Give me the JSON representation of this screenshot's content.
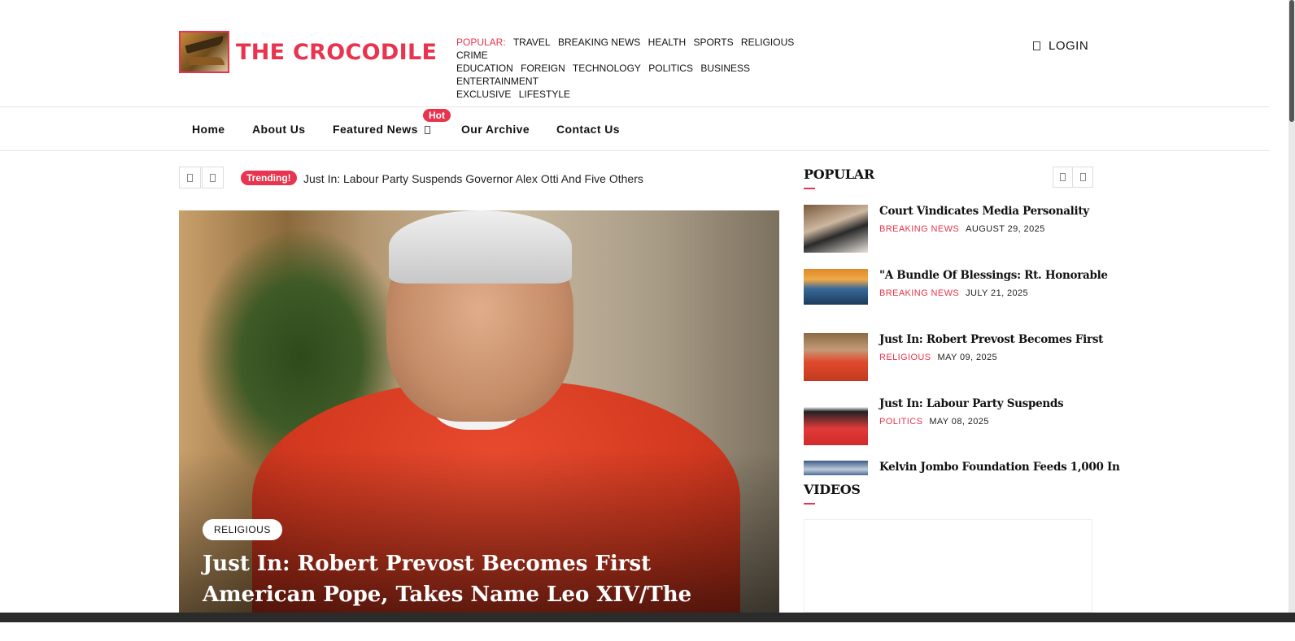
{
  "header": {
    "logo_text": "THE CROCODILE",
    "popular_label": "POPULAR:",
    "popular_links": [
      "TRAVEL",
      "BREAKING NEWS",
      "HEALTH",
      "SPORTS",
      "RELIGIOUS",
      "CRIME",
      "EDUCATION",
      "FOREIGN",
      "TECHNOLOGY",
      "POLITICS",
      "BUSINESS",
      "ENTERTAINMENT",
      "EXCLUSIVE",
      "LIFESTYLE"
    ],
    "login_label": "LOGIN"
  },
  "nav": {
    "items": [
      "Home",
      "About Us",
      "Featured News",
      "Our Archive",
      "Contact Us"
    ],
    "hot_badge": "Hot"
  },
  "trending": {
    "badge": "Trending!",
    "text": "Just In: Labour Party Suspends Governor Alex Otti And Five Others"
  },
  "hero": {
    "category": "RELIGIOUS",
    "title": "Just In: Robert Prevost Becomes First American Pope, Takes Name Leo XIV/The Crocodile News"
  },
  "sidebar": {
    "popular_title": "POPULAR",
    "videos_title": "VIDEOS",
    "posts": [
      {
        "title": "Court Vindicates Media Personality",
        "category": "BREAKING NEWS",
        "date": "AUGUST 29, 2025"
      },
      {
        "title": "\"A Bundle Of Blessings: Rt. Honorable",
        "category": "BREAKING NEWS",
        "date": "JULY 21, 2025"
      },
      {
        "title": "Just In: Robert Prevost Becomes First",
        "category": "RELIGIOUS",
        "date": "MAY 09, 2025"
      },
      {
        "title": "Just In: Labour Party Suspends",
        "category": "POLITICS",
        "date": "MAY 08, 2025"
      },
      {
        "title": "Kelvin Jombo Foundation Feeds 1,000 In",
        "category": "",
        "date": ""
      }
    ]
  },
  "colors": {
    "accent": "#e8344e"
  }
}
